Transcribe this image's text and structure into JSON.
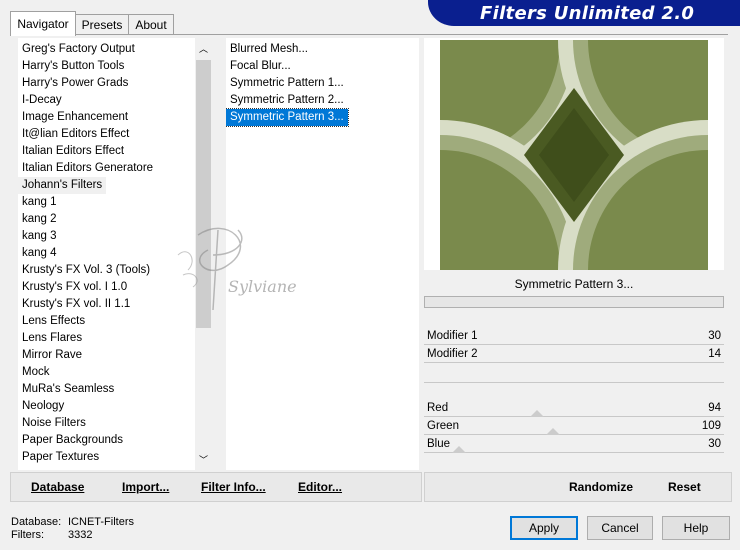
{
  "tabs": [
    {
      "label": "Navigator"
    },
    {
      "label": "Presets"
    },
    {
      "label": "About"
    }
  ],
  "banner": {
    "title": "Filters Unlimited 2.0"
  },
  "categories": [
    "Greg's Factory Output",
    "Harry's Button Tools",
    "Harry's Power Grads",
    "I-Decay",
    "Image Enhancement",
    "It@lian Editors Effect",
    "Italian Editors Effect",
    "Italian Editors Generatore",
    "Johann's Filters",
    "kang 1",
    "kang 2",
    "kang 3",
    "kang 4",
    "Krusty's FX Vol. 3 (Tools)",
    "Krusty's FX vol. I 1.0",
    "Krusty's FX vol. II 1.1",
    "Lens Effects",
    "Lens Flares",
    "Mirror Rave",
    "Mock",
    "MuRa's Seamless",
    "Neology",
    "Noise Filters",
    "Paper Backgrounds",
    "Paper Textures"
  ],
  "filters": [
    "Blurred Mesh...",
    "Focal Blur...",
    "Symmetric Pattern 1...",
    "Symmetric Pattern 2...",
    "Symmetric Pattern 3..."
  ],
  "preview": {
    "caption": "Symmetric Pattern 3...",
    "base_color": "#5e6d31"
  },
  "modifiers": [
    {
      "label": "Modifier 1",
      "value": "30"
    },
    {
      "label": "Modifier 2",
      "value": "14"
    }
  ],
  "colors": [
    {
      "label": "Red",
      "value": "94"
    },
    {
      "label": "Green",
      "value": "109"
    },
    {
      "label": "Blue",
      "value": "30"
    }
  ],
  "bottom_buttons": {
    "database": "Database",
    "import": "Import...",
    "filter_info": "Filter Info...",
    "editor": "Editor...",
    "randomize": "Randomize",
    "reset": "Reset"
  },
  "status": {
    "database_label": "Database:",
    "database_value": "ICNET-Filters",
    "filters_label": "Filters:",
    "filters_value": "3332"
  },
  "dialog": {
    "apply": "Apply",
    "cancel": "Cancel",
    "help": "Help"
  },
  "watermark": "Sylviane"
}
